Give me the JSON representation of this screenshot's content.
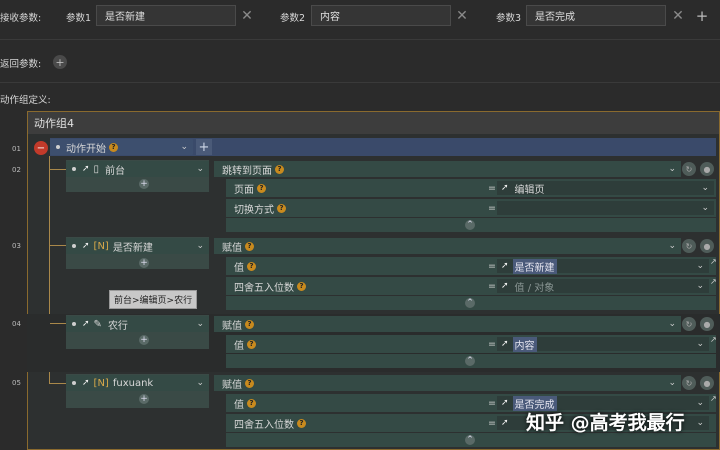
{
  "params": {
    "receive_label": "接收参数:",
    "items": [
      {
        "label": "参数1",
        "value": "是否新建"
      },
      {
        "label": "参数2",
        "value": "内容"
      },
      {
        "label": "参数3",
        "value": "是否完成"
      }
    ],
    "return_label": "返回参数:",
    "group_def_label": "动作组定义:"
  },
  "panel": {
    "title": "动作组4",
    "start_label": "动作开始",
    "rows": [
      {
        "num": "01",
        "label": "动作开始"
      },
      {
        "num": "02",
        "node": "前台",
        "action": "跳转到页面",
        "params": [
          {
            "label": "页面",
            "value": "编辑页"
          },
          {
            "label": "切换方式",
            "value": ""
          }
        ]
      },
      {
        "num": "03",
        "node": "是否新建",
        "action": "赋值",
        "params": [
          {
            "label": "值",
            "value": "是否新建"
          },
          {
            "label": "四舍五入位数",
            "value": "值 / 对象"
          }
        ]
      },
      {
        "num": "04",
        "node": "农行",
        "action": "赋值",
        "params": [
          {
            "label": "值",
            "value": "内容"
          }
        ]
      },
      {
        "num": "05",
        "node": "fuxuank",
        "action": "赋值",
        "params": [
          {
            "label": "值",
            "value": "是否完成"
          },
          {
            "label": "四舍五入位数",
            "value": ""
          }
        ]
      }
    ]
  },
  "tooltip": "前台>编辑页>农行",
  "watermark": "知乎 @高考我最行",
  "eq": "="
}
